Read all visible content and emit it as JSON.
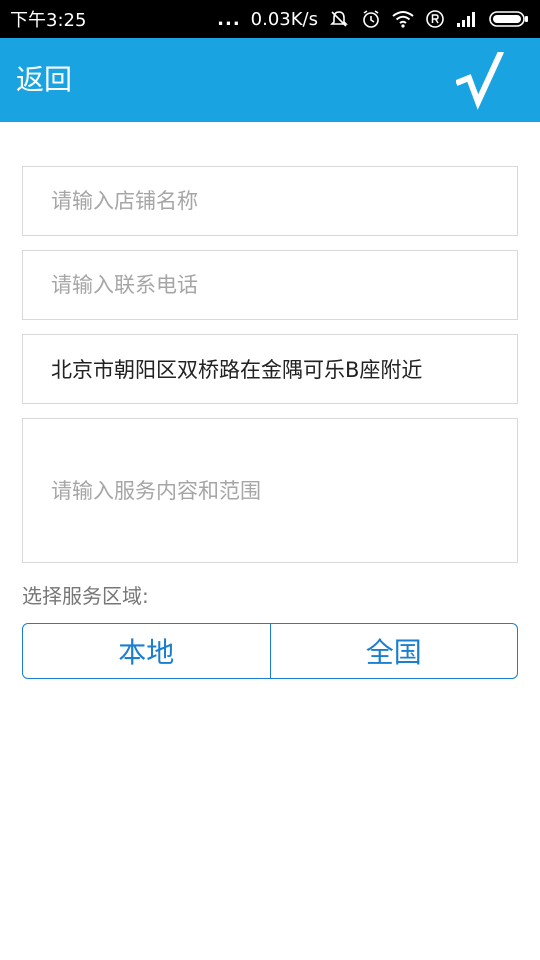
{
  "status_bar": {
    "time": "下午3:25",
    "dots": "...",
    "network_speed": "0.03K/s"
  },
  "header": {
    "back_label": "返回",
    "confirm_label": "√"
  },
  "form": {
    "shop_name": {
      "value": "",
      "placeholder": "请输入店铺名称"
    },
    "phone": {
      "value": "",
      "placeholder": "请输入联系电话"
    },
    "address": {
      "value": "北京市朝阳区双桥路在金隅可乐B座附近",
      "placeholder": ""
    },
    "service": {
      "value": "",
      "placeholder": "请输入服务内容和范围"
    },
    "region_label": "选择服务区域:",
    "region_options": [
      {
        "label": "本地"
      },
      {
        "label": "全国"
      }
    ]
  },
  "colors": {
    "header_bg": "#1aa3e1",
    "accent": "#1a7fd0",
    "border": "#d9d9d9"
  }
}
